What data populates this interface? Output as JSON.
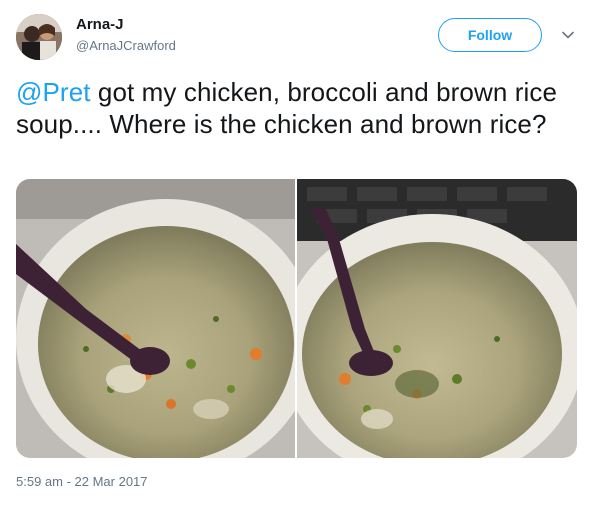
{
  "user": {
    "display_name": "Arna-J",
    "handle": "@ArnaJCrawford",
    "avatar_icon": "profile-photo"
  },
  "follow_button": {
    "label": "Follow"
  },
  "menu": {
    "icon": "chevron-down-icon"
  },
  "tweet": {
    "mention": "@Pret",
    "text": " got my chicken, broccoli and brown rice soup.... Where is the chicken and brown rice?"
  },
  "media": [
    {
      "description_icon": "soup-cup-photo"
    },
    {
      "description_icon": "soup-cup-photo"
    }
  ],
  "timestamp": "5:59 am - 22 Mar 2017",
  "colors": {
    "accent": "#1da1f2",
    "text": "#14171a",
    "secondary": "#657786"
  }
}
